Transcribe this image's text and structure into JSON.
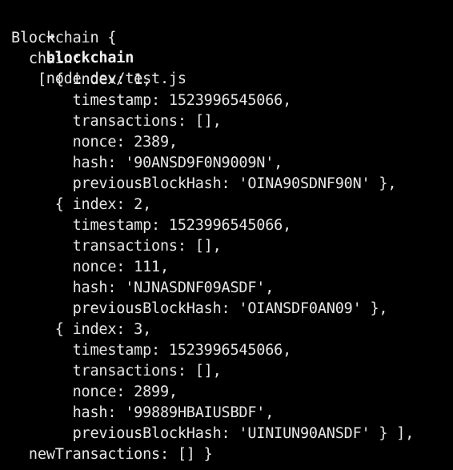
{
  "terminal": {
    "prompt": {
      "arrow": "➜",
      "directory": "blockchain",
      "command": "node dev/test.js"
    },
    "output_lines": [
      "Blockchain {",
      "  chain:",
      "   [ { index: 1,",
      "       timestamp: 1523996545066,",
      "       transactions: [],",
      "       nonce: 2389,",
      "       hash: '90ANSD9F0N9009N',",
      "       previousBlockHash: 'OINA90SDNF90N' },",
      "     { index: 2,",
      "       timestamp: 1523996545066,",
      "       transactions: [],",
      "       nonce: 111,",
      "       hash: 'NJNASDNF09ASDF',",
      "       previousBlockHash: 'OIANSDF0AN09' },",
      "     { index: 3,",
      "       timestamp: 1523996545066,",
      "       transactions: [],",
      "       nonce: 2899,",
      "       hash: '99889HBAIUSBDF',",
      "       previousBlockHash: 'UINIUN90ANSDF' } ],",
      "  newTransactions: [] }"
    ]
  }
}
